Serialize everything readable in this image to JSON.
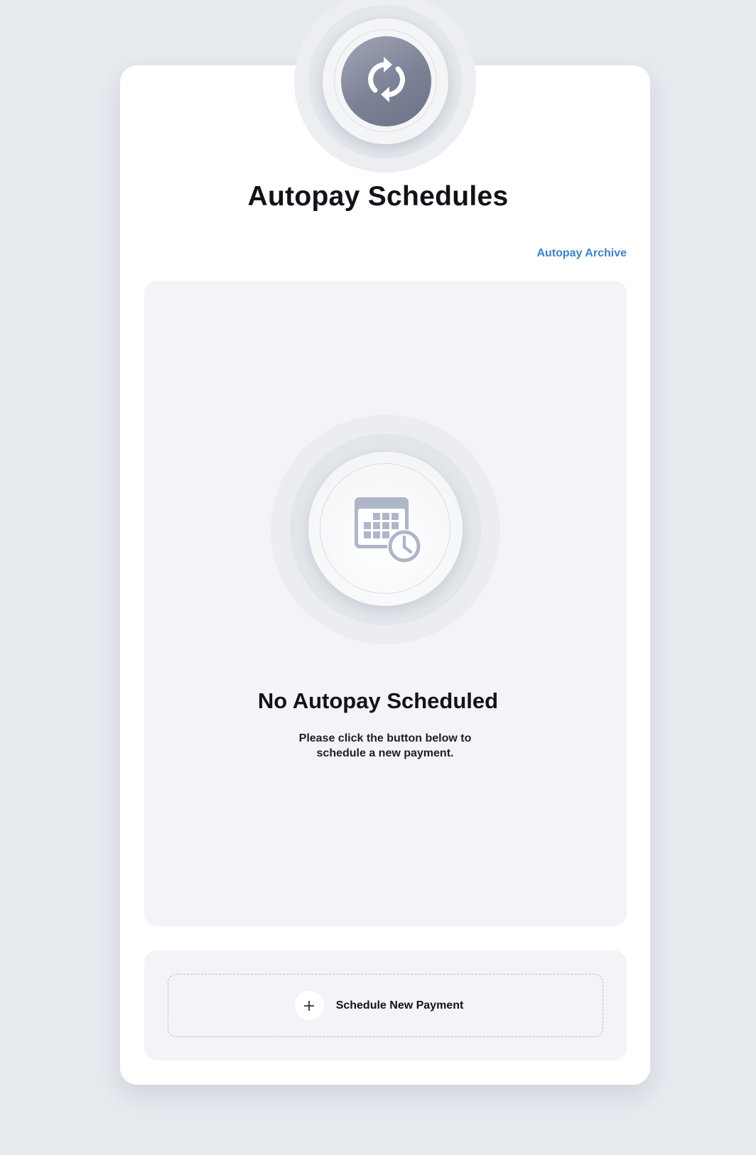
{
  "header": {
    "badge_icon": "sync-icon",
    "title": "Autopay Schedules",
    "archive_link": "Autopay Archive"
  },
  "empty_state": {
    "icon": "calendar-clock-icon",
    "title": "No Autopay Scheduled",
    "description": "Please click the button below to schedule a new payment."
  },
  "actions": {
    "schedule_icon": "plus-icon",
    "schedule_label": "Schedule New Payment"
  },
  "colors": {
    "background": "#e7eaef",
    "card": "#ffffff",
    "panel": "#f2f4f7",
    "link": "#3d82c4",
    "badge": "#7c8296",
    "icon": "#b0b6c9"
  }
}
